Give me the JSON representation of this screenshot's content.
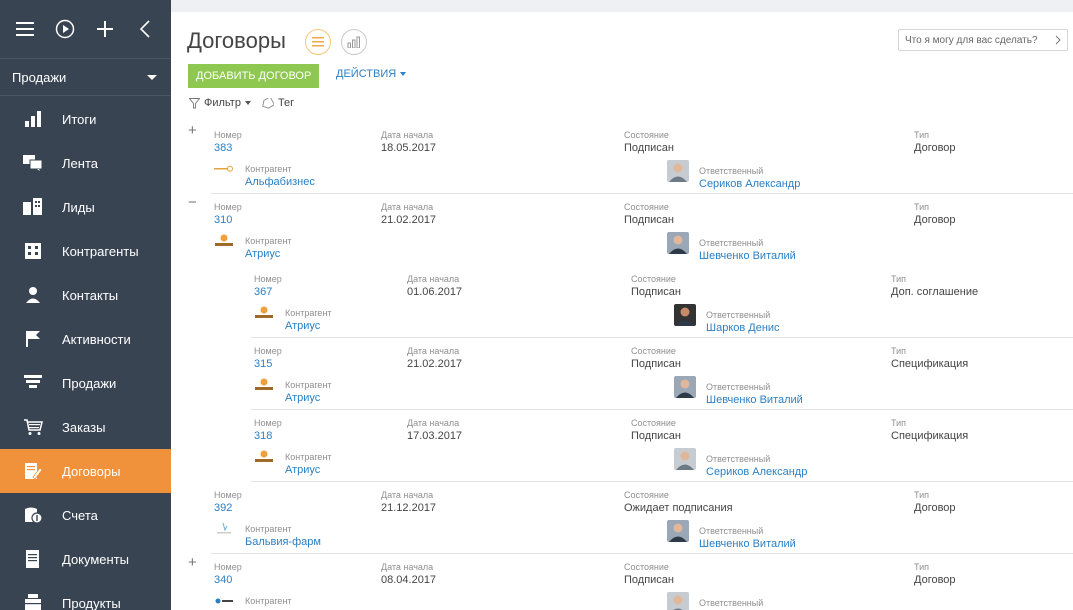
{
  "sidebar": {
    "workplace": "Продажи",
    "items": [
      {
        "label": "Итоги"
      },
      {
        "label": "Лента"
      },
      {
        "label": "Лиды"
      },
      {
        "label": "Контрагенты"
      },
      {
        "label": "Контакты"
      },
      {
        "label": "Активности"
      },
      {
        "label": "Продажи"
      },
      {
        "label": "Заказы"
      },
      {
        "label": "Договоры"
      },
      {
        "label": "Счета"
      },
      {
        "label": "Документы"
      },
      {
        "label": "Продукты"
      }
    ],
    "active_color": "#f0923b",
    "background_color": "#394453"
  },
  "header": {
    "title": "Договоры",
    "search_placeholder": "Что я могу для вас сделать?",
    "add_button": "ДОБАВИТЬ ДОГОВОР",
    "actions": "ДЕЙСТВИЯ",
    "filter": "Фильтр",
    "tag": "Тег"
  },
  "labels": {
    "number": "Номер",
    "start_date": "Дата начала",
    "state": "Состояние",
    "type": "Тип",
    "counterparty": "Контрагент",
    "owner": "Ответственный"
  },
  "rows": [
    {
      "number": "383",
      "date": "18.05.2017",
      "state": "Подписан",
      "type": "Договор",
      "counterparty": "Альфабизнес",
      "owner": "Сериков Александр",
      "toggle": "+"
    },
    {
      "number": "310",
      "date": "21.02.2017",
      "state": "Подписан",
      "type": "Договор",
      "counterparty": "Атриус",
      "owner": "Шевченко Виталий",
      "toggle": "−"
    },
    {
      "number": "367",
      "date": "01.06.2017",
      "state": "Подписан",
      "type": "Доп. соглашение",
      "counterparty": "Атриус",
      "owner": "Шарков Денис"
    },
    {
      "number": "315",
      "date": "21.02.2017",
      "state": "Подписан",
      "type": "Спецификация",
      "counterparty": "Атриус",
      "owner": "Шевченко Виталий"
    },
    {
      "number": "318",
      "date": "17.03.2017",
      "state": "Подписан",
      "type": "Спецификация",
      "counterparty": "Атриус",
      "owner": "Сериков Александр"
    },
    {
      "number": "392",
      "date": "21.12.2017",
      "state": "Ожидает подписания",
      "type": "Договор",
      "counterparty": "Бальвия-фарм",
      "owner": "Шевченко Виталий"
    },
    {
      "number": "340",
      "date": "08.04.2017",
      "state": "Подписан",
      "type": "Договор",
      "counterparty": "",
      "owner": "",
      "toggle": "+"
    }
  ]
}
